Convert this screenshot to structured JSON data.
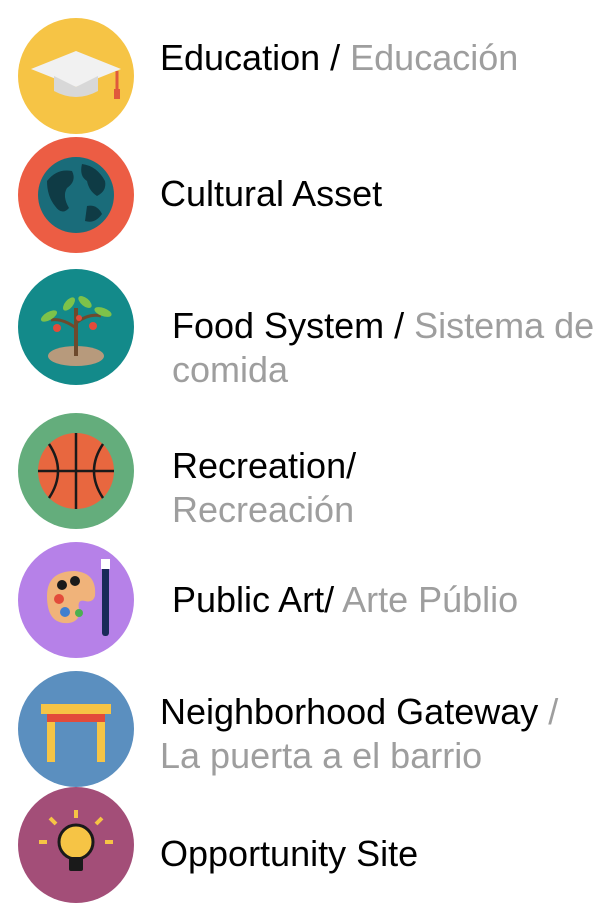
{
  "legend": {
    "items": [
      {
        "id": "education",
        "primary": "Education /",
        "secondary": "Educación",
        "icon": "graduation-cap-icon",
        "color": "#f6c445"
      },
      {
        "id": "cultural-asset",
        "primary": "Cultural Asset",
        "secondary": "",
        "icon": "globe-icon",
        "color": "#ec5d44"
      },
      {
        "id": "food-system",
        "primary": "Food System /",
        "secondary": "Sistema de comida",
        "icon": "plant-icon",
        "color": "#138a8a"
      },
      {
        "id": "recreation",
        "primary": "Recreation/",
        "secondary": "Recreación",
        "icon": "basketball-icon",
        "color": "#64ad7c"
      },
      {
        "id": "public-art",
        "primary": "Public Art/",
        "secondary": "Arte Públio",
        "icon": "paint-palette-icon",
        "color": "#b681e8"
      },
      {
        "id": "neighborhood-gateway",
        "primary": "Neighborhood Gateway",
        "secondary": "/ La puerta a el barrio",
        "icon": "gateway-icon",
        "color": "#5b8fbf"
      },
      {
        "id": "opportunity-site",
        "primary": "Opportunity Site",
        "secondary": "",
        "icon": "lightbulb-icon",
        "color": "#a34e78"
      }
    ]
  }
}
